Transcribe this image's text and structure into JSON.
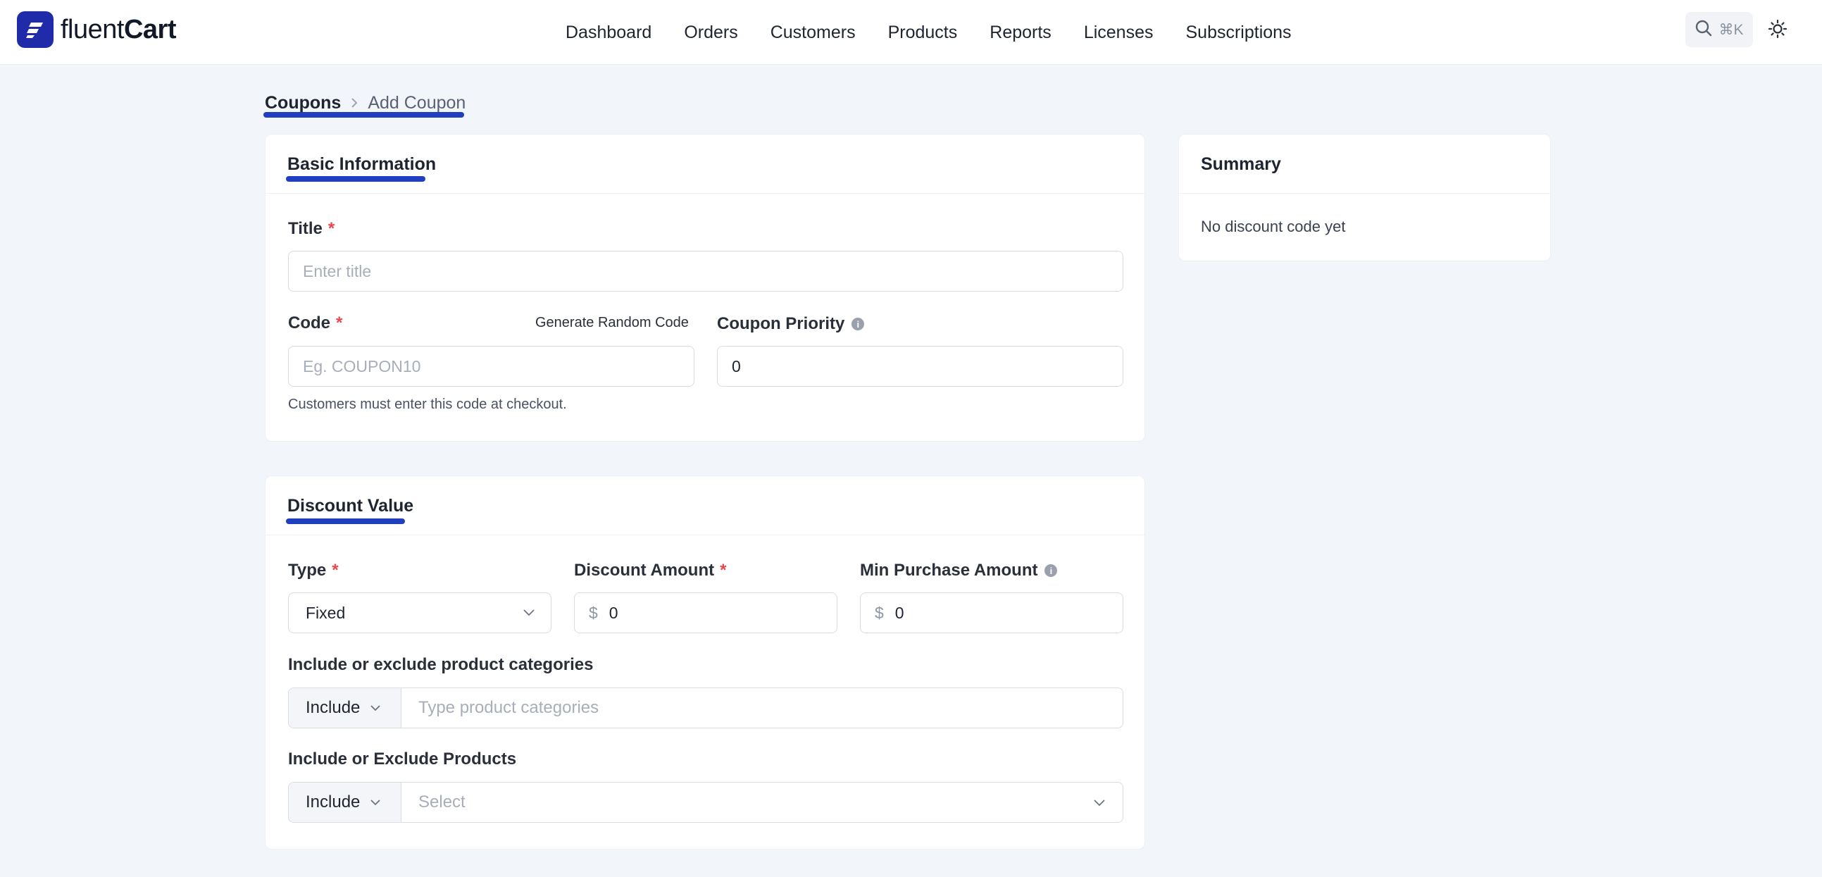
{
  "app": {
    "logo_text_light": "fluent",
    "logo_text_bold": "Cart"
  },
  "nav": {
    "items": [
      "Dashboard",
      "Orders",
      "Customers",
      "Products",
      "Reports",
      "Licenses",
      "Subscriptions"
    ]
  },
  "search": {
    "shortcut": "⌘K"
  },
  "breadcrumb": {
    "parent": "Coupons",
    "current": "Add Coupon"
  },
  "basic_info": {
    "title": "Basic Information",
    "title_label": "Title",
    "title_placeholder": "Enter title",
    "code_label": "Code",
    "generate_label": "Generate Random Code",
    "code_placeholder": "Eg. COUPON10",
    "code_help": "Customers must enter this code at checkout.",
    "priority_label": "Coupon Priority",
    "priority_value": "0"
  },
  "discount": {
    "title": "Discount Value",
    "type_label": "Type",
    "type_value": "Fixed",
    "amount_label": "Discount Amount",
    "currency": "$",
    "amount_value": "0",
    "min_label": "Min Purchase Amount",
    "min_value": "0",
    "categories_label": "Include or exclude product categories",
    "categories_mode": "Include",
    "categories_placeholder": "Type product categories",
    "products_label": "Include or Exclude Products",
    "products_mode": "Include",
    "products_placeholder": "Select"
  },
  "summary": {
    "title": "Summary",
    "empty_text": "No discount code yet"
  },
  "colors": {
    "accent": "#1f3fbf",
    "logo_bg": "#1f2ba8",
    "required": "#e5484d"
  }
}
